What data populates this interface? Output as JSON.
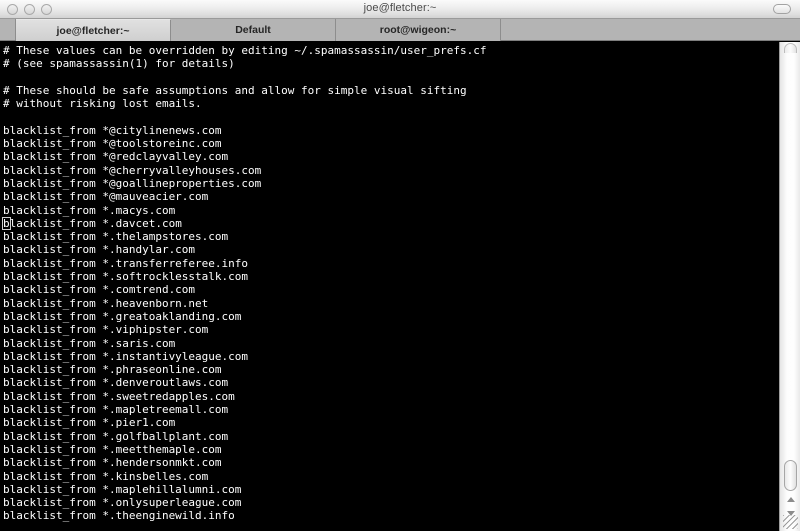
{
  "window": {
    "title": "joe@fletcher:~",
    "traffic_lights": [
      "close",
      "minimize",
      "zoom"
    ],
    "toolbar_toggle_label": ""
  },
  "tabs": [
    {
      "label": "joe@fletcher:~",
      "active": true
    },
    {
      "label": "Default",
      "active": false
    },
    {
      "label": "root@wigeon:~",
      "active": false
    }
  ],
  "terminal": {
    "background_color": "#000000",
    "text_color": "#ffffff",
    "cursor_line_index": 13,
    "cursor_column": 0,
    "lines": [
      "# These values can be overridden by editing ~/.spamassassin/user_prefs.cf",
      "# (see spamassassin(1) for details)",
      "",
      "# These should be safe assumptions and allow for simple visual sifting",
      "# without risking lost emails.",
      "",
      "blacklist_from *@citylinenews.com",
      "blacklist_from *@toolstoreinc.com",
      "blacklist_from *@redclayvalley.com",
      "blacklist_from *@cherryvalleyhouses.com",
      "blacklist_from *@goallineproperties.com",
      "blacklist_from *@mauveacier.com",
      "blacklist_from *.macys.com",
      "blacklist_from *.davcet.com",
      "blacklist_from *.thelampstores.com",
      "blacklist_from *.handylar.com",
      "blacklist_from *.transferreferee.info",
      "blacklist_from *.softrocklesstalk.com",
      "blacklist_from *.comtrend.com",
      "blacklist_from *.heavenborn.net",
      "blacklist_from *.greatoaklanding.com",
      "blacklist_from *.viphipster.com",
      "blacklist_from *.saris.com",
      "blacklist_from *.instantivyleague.com",
      "blacklist_from *.phraseonline.com",
      "blacklist_from *.denveroutlaws.com",
      "blacklist_from *.sweetredapples.com",
      "blacklist_from *.mapletreemall.com",
      "blacklist_from *.pier1.com",
      "blacklist_from *.golfballplant.com",
      "blacklist_from *.meetthemaple.com",
      "blacklist_from *.hendersonmkt.com",
      "blacklist_from *.kinsbelles.com",
      "blacklist_from *.maplehillalumni.com",
      "blacklist_from *.onlysuperleague.com",
      "blacklist_from *.theenginewild.info"
    ]
  },
  "scrollbar": {
    "orientation": "vertical",
    "thumb_position": "near-bottom"
  }
}
